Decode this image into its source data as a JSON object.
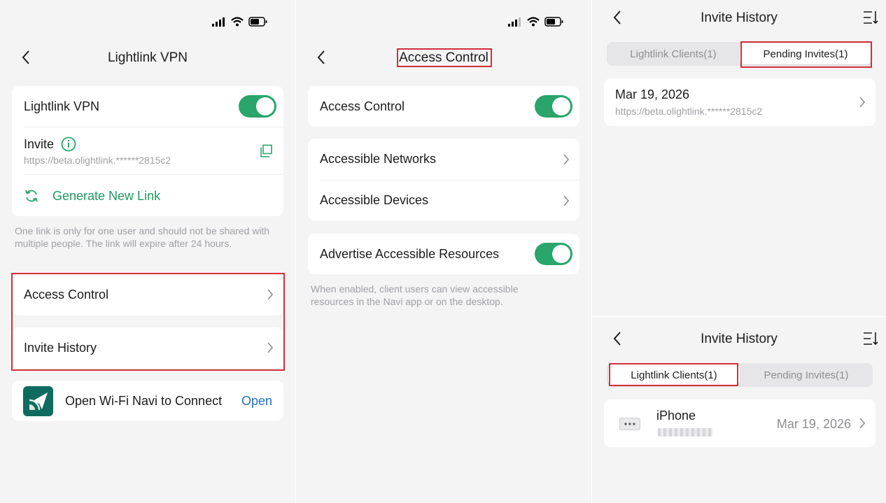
{
  "screen1": {
    "title": "Lightlink VPN",
    "vpn_label": "Lightlink VPN",
    "invite_label": "Invite",
    "invite_link": "https://beta.olightlink.******2815c2",
    "generate_label": "Generate New Link",
    "hint": "One link is only for one user and should not be shared with multiple people. The link will expire after 24 hours.",
    "access_control_label": "Access Control",
    "invite_history_label": "Invite History",
    "navi_label": "Open Wi-Fi Navi to Connect",
    "open_label": "Open"
  },
  "screen2": {
    "title": "Access Control",
    "access_control_label": "Access Control",
    "networks_label": "Accessible Networks",
    "devices_label": "Accessible Devices",
    "advertise_label": "Advertise Accessible Resources",
    "hint": "When enabled, client users can view accessible resources in the Navi app or on the desktop."
  },
  "screen3_top": {
    "title": "Invite History",
    "tab_clients": "Lightlink Clients(1)",
    "tab_pending": "Pending Invites(1)",
    "date": "Mar 19, 2026",
    "link": "https://beta.olightlink.******2815c2"
  },
  "screen3_bottom": {
    "title": "Invite History",
    "tab_clients": "Lightlink Clients(1)",
    "tab_pending": "Pending Invites(1)",
    "device_name": "iPhone",
    "date": "Mar 19, 2026"
  },
  "colors": {
    "accent_green": "#2aa56b",
    "link_blue": "#1f6fcf",
    "highlight_red": "#d32f3a"
  }
}
